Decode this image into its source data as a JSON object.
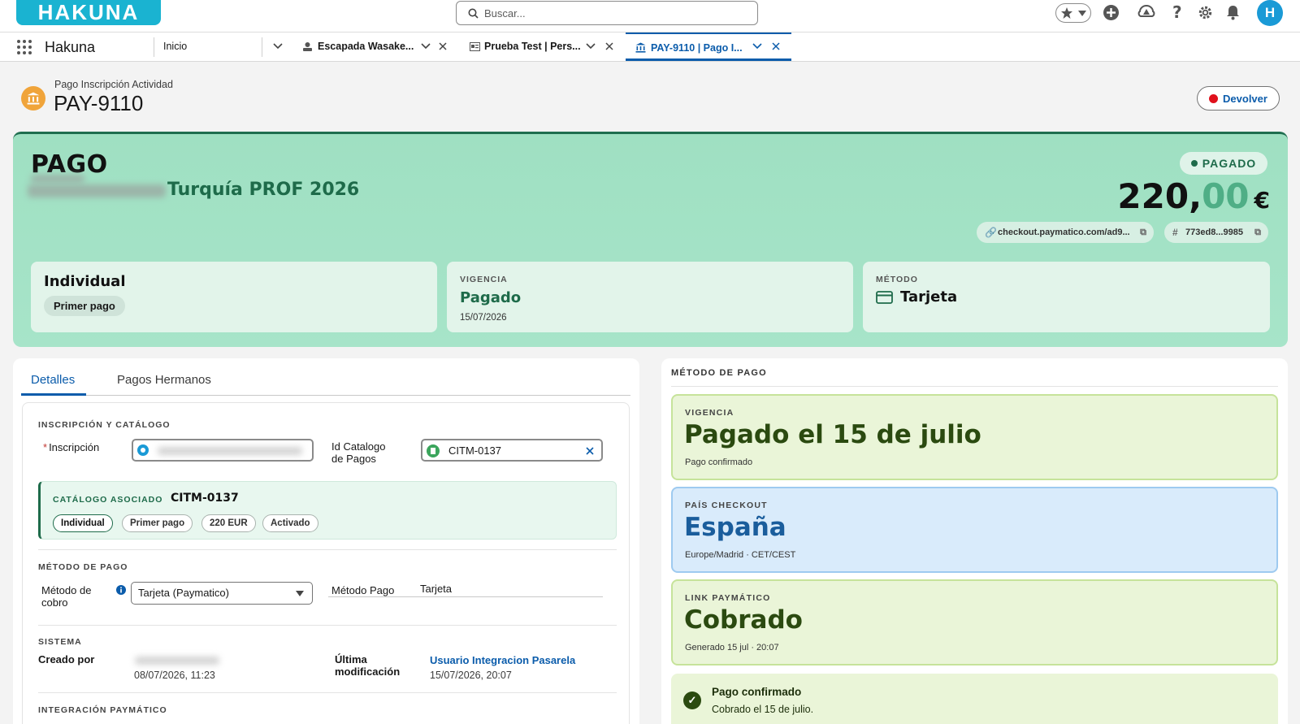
{
  "app": {
    "logo": "HAKUNA",
    "name": "Hakuna"
  },
  "search": {
    "placeholder": "Buscar..."
  },
  "tabs": [
    {
      "label": "Inicio"
    },
    {
      "label": "Escapada Wasake..."
    },
    {
      "label": "Prueba Test | Pers..."
    },
    {
      "label": "PAY-9110 | Pago I..."
    }
  ],
  "user": {
    "initial": "H"
  },
  "record": {
    "object_label": "Pago Inscripción Actividad",
    "title": "PAY-9110",
    "action_label": "Devolver"
  },
  "hero": {
    "kicker": "PAGO",
    "name_suffix": "Turquía PROF 2026",
    "status": "PAGADO",
    "amount_int": "220,",
    "amount_dec": "00",
    "currency": "€",
    "checkout_chip": "checkout.paymatico.com/ad9...",
    "id_chip": "773ed8...9985",
    "cards": {
      "type_title": "Individual",
      "type_pill": "Primer pago",
      "vigencia_label": "VIGENCIA",
      "vigencia_value": "Pagado",
      "vigencia_date": "15/07/2026",
      "metodo_label": "MÉTODO",
      "metodo_value": "Tarjeta"
    }
  },
  "detail_tabs": {
    "detalles": "Detalles",
    "hermanos": "Pagos Hermanos"
  },
  "details": {
    "sec_inscripcion": "INSCRIPCIÓN Y CATÁLOGO",
    "inscripcion_label": "Inscripción",
    "catalogo_label_1": "Id Catalogo",
    "catalogo_label_2": "de Pagos",
    "catalogo_value": "CITM-0137",
    "assoc_label": "CATÁLOGO ASOCIADO",
    "assoc_value": "CITM-0137",
    "assoc_tags": [
      "Individual",
      "Primer pago",
      "220 EUR",
      "Activado"
    ],
    "sec_metodo": "MÉTODO DE PAGO",
    "metodo_cobro_label_1": "Método de",
    "metodo_cobro_label_2": "cobro",
    "metodo_cobro_value": "Tarjeta (Paymatico)",
    "metodo_pago_label": "Método Pago",
    "metodo_pago_value": "Tarjeta",
    "sec_sistema": "SISTEMA",
    "creado_label": "Creado por",
    "creado_date": "08/07/2026, 11:23",
    "modif_label_1": "Última",
    "modif_label_2": "modificación",
    "modif_user": "Usuario Integracion Pasarela",
    "modif_date": "15/07/2026, 20:07",
    "sec_integracion": "INTEGRACIÓN PAYMÁTICO"
  },
  "payment_panel": {
    "title": "MÉTODO DE PAGO",
    "vigencia": {
      "label": "VIGENCIA",
      "value": "Pagado el 15 de julio",
      "sub": "Pago confirmado"
    },
    "pais": {
      "label": "PAÍS CHECKOUT",
      "value": "España",
      "sub": "Europe/Madrid · CET/CEST"
    },
    "link": {
      "label": "LINK PAYMÁTICO",
      "value": "Cobrado",
      "sub": "Generado 15 jul · 20:07"
    },
    "confirm": {
      "title": "Pago confirmado",
      "sub": "Cobrado el 15 de julio."
    }
  },
  "colors": {
    "brand": "#1ab3d1",
    "accent": "#0b5cab",
    "paid_green": "#1e6b4a",
    "hero_bg": "#a7e4c9"
  }
}
